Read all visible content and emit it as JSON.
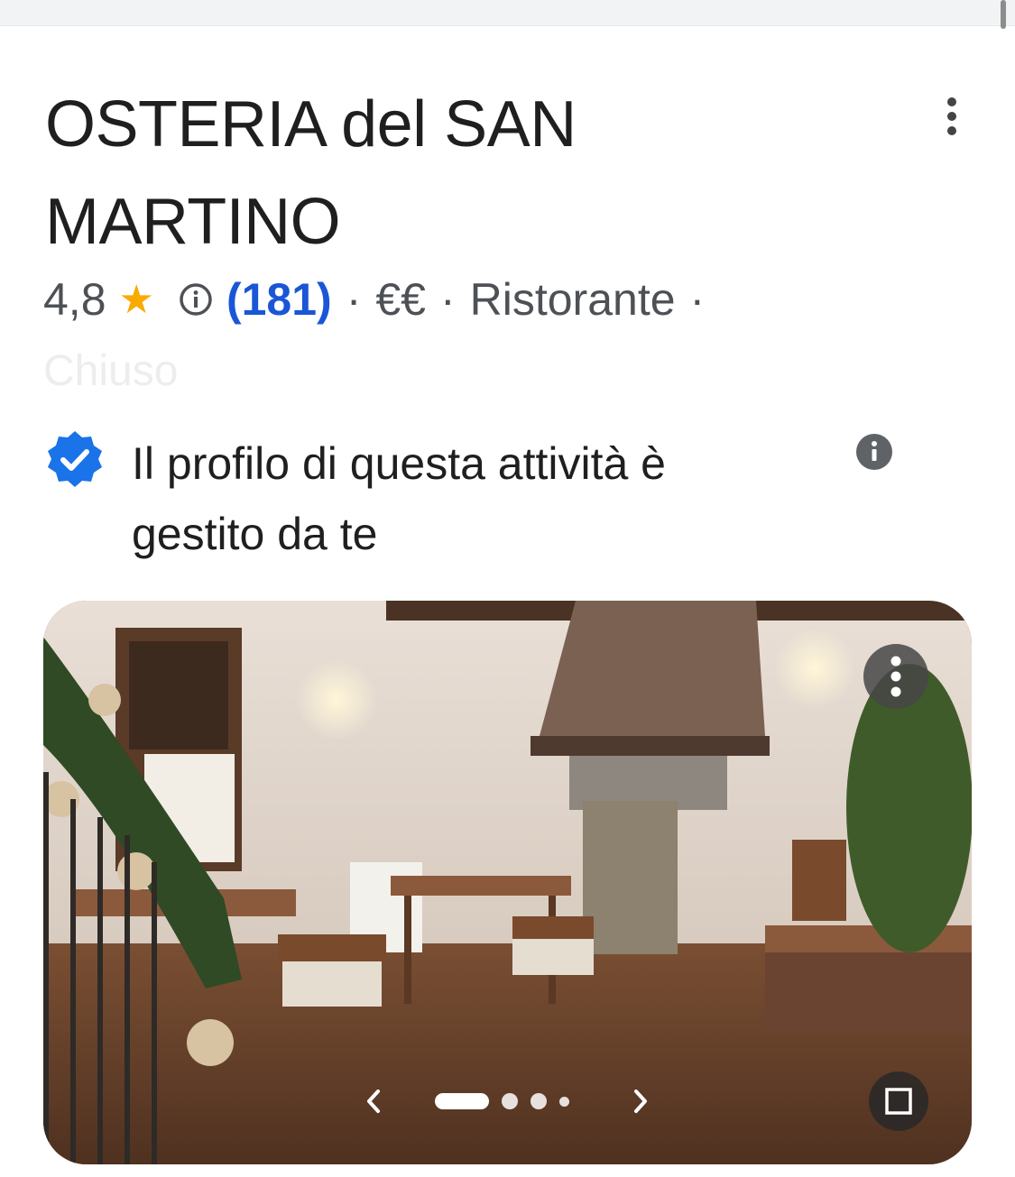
{
  "business": {
    "name_line1": "OSTERIA del SAN",
    "name_line2": "MARTINO",
    "rating": "4,8",
    "star": "★",
    "reviews": "(181)",
    "separator": "·",
    "price": "€€",
    "category": "Ristorante",
    "status": "Chiuso"
  },
  "ownership": {
    "text_line1": "Il profilo di questa attività è",
    "text_line2": "gestito da te"
  },
  "carousel": {
    "pages": 4,
    "active_index": 0
  },
  "colors": {
    "accent_blue": "#1a56d6",
    "verified_blue": "#1a73e8",
    "star_yellow": "#f9ab00",
    "text_dark": "#1f1f1f",
    "text_secondary": "#4d5156"
  },
  "icons": {
    "more": "more-vert-icon",
    "info_outline": "info-outline-icon",
    "verified": "verified-badge-icon",
    "info_filled": "info-filled-icon",
    "prev": "chevron-left-icon",
    "next": "chevron-right-icon",
    "expand": "fullscreen-icon"
  }
}
